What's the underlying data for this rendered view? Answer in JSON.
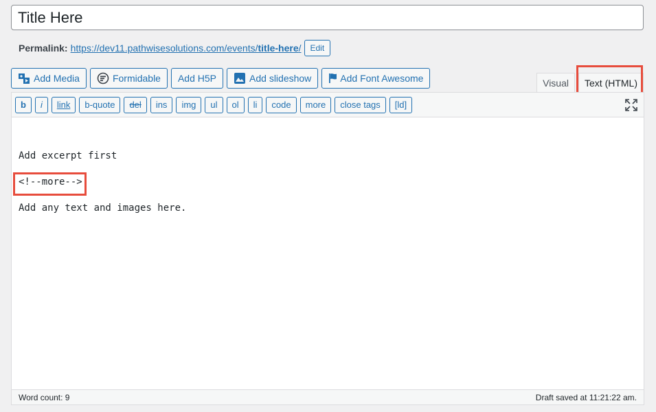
{
  "title": {
    "value": "Title Here"
  },
  "permalink": {
    "label": "Permalink:",
    "url_base": "https://dev11.pathwisesolutions.com/events/",
    "slug": "title-here",
    "slash": "/",
    "edit_label": "Edit"
  },
  "media_buttons": [
    {
      "label": "Add Media",
      "icon": "media-icon"
    },
    {
      "label": "Formidable",
      "icon": "formidable-icon"
    },
    {
      "label": "Add H5P",
      "icon": ""
    },
    {
      "label": "Add slideshow",
      "icon": "image-icon"
    },
    {
      "label": "Add Font Awesome",
      "icon": "flag-icon"
    }
  ],
  "tabs": {
    "visual": "Visual",
    "text": "Text (HTML)"
  },
  "quicktags": [
    "b",
    "i",
    "link",
    "b-quote",
    "del",
    "ins",
    "img",
    "ul",
    "ol",
    "li",
    "code",
    "more",
    "close tags",
    "[ld]"
  ],
  "content": {
    "line1": "Add excerpt first",
    "line2": "<!--more-->",
    "line3": "Add any text and images here."
  },
  "status": {
    "word_count": "Word count: 9",
    "draft_saved": "Draft saved at 11:21:22 am."
  },
  "colors": {
    "accent": "#2271b1",
    "highlight": "#e74c3c"
  }
}
